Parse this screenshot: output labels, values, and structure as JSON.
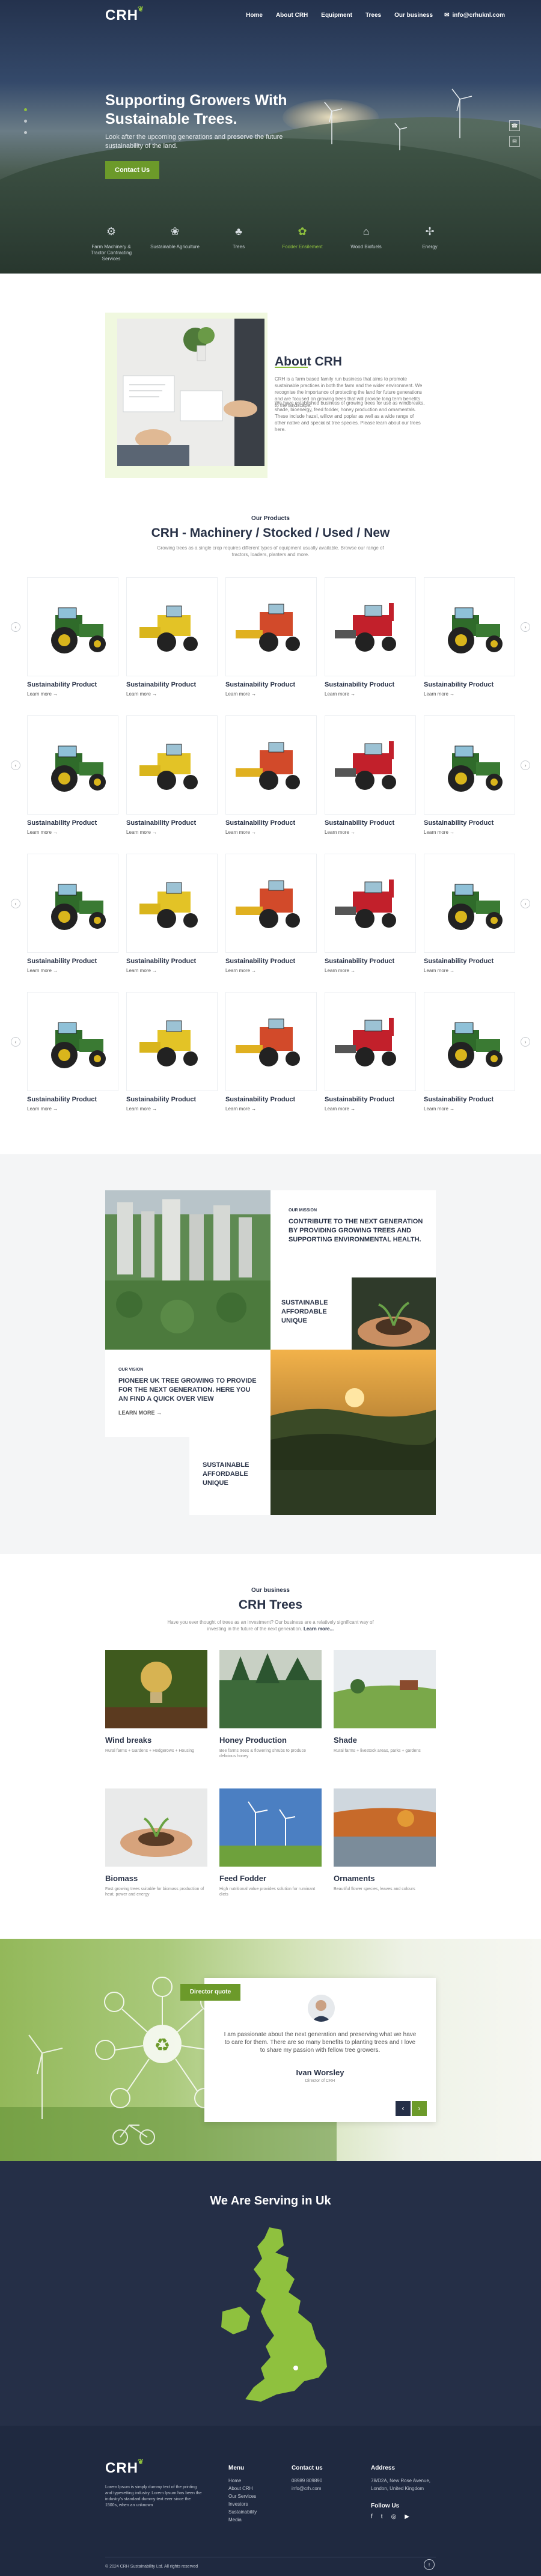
{
  "nav": {
    "logo": "CRH",
    "links": [
      "Home",
      "About CRH",
      "Equipment",
      "Trees",
      "Our business"
    ],
    "email": "info@crhuknl.com"
  },
  "hero": {
    "title": "Supporting Growers With Sustainable Trees.",
    "subtitle": "Look after the upcoming generations and preserve the future sustainability of the land.",
    "cta": "Contact Us",
    "features": [
      {
        "icon": "tractor-icon",
        "label": "Farm Machinery & Tractor Contracting Services"
      },
      {
        "icon": "seedling-icon",
        "label": "Sustainable Agriculture"
      },
      {
        "icon": "tree-icon",
        "label": "Trees"
      },
      {
        "icon": "fodder-icon",
        "label": "Fodder Ensilement"
      },
      {
        "icon": "farm-icon",
        "label": "Wood Biofuels"
      },
      {
        "icon": "wind-icon",
        "label": "Energy"
      }
    ]
  },
  "about": {
    "title": "About CRH",
    "p1": "CRH is a farm based family run business that aims to promote sustainable practices in both the farm and the wider environment. We recognise the importance of protecting the land for future generations and are focused on growing trees that will provide long term benefits to the landscape.",
    "p2": "We have established business of growing trees for use as windbreaks, shade, bioenergy, feed fodder, honey production and ornamentals. These include hazel, willow and poplar as well as a wide range of other native and specialist tree species. Please learn about our trees here."
  },
  "products": {
    "kicker": "Our Products",
    "title": "CRH - Machinery / Stocked / Used / New",
    "desc": "Growing trees as a single crop requires different types of equipment usually available. Browse our range of tractors, loaders, planters and more.",
    "item_name": "Sustainability Product",
    "item_link": "Learn more",
    "rows": [
      [
        "tractor",
        "harvester",
        "combine",
        "forage",
        "tractor"
      ],
      [
        "tractor",
        "harvester",
        "combine",
        "forage",
        "tractor"
      ],
      [
        "tractor",
        "harvester",
        "combine",
        "forage",
        "tractor"
      ],
      [
        "tractor",
        "harvester",
        "combine",
        "forage",
        "tractor"
      ]
    ]
  },
  "mission": {
    "mission_kicker": "OUR MISSION",
    "mission_text": "CONTRIBUTE TO THE NEXT GENERATION BY PROVIDING GROWING TREES AND SUPPORTING ENVIRONMENTAL HEALTH.",
    "badge1": "SUSTAINABLE AFFORDABLE UNIQUE",
    "vision_kicker": "OUR VISION",
    "vision_text": "PIONEER UK TREE GROWING TO PROVIDE FOR THE NEXT GENERATION. HERE YOU AN FIND A QUICK OVER VIEW",
    "learn_more": "LEARN MORE",
    "badge2": "SUSTAINABLE AFFORDABLE UNIQUE"
  },
  "trees": {
    "kicker": "Our business",
    "title": "CRH Trees",
    "desc": "Have you ever thought of trees as an investment? Our business are a relatively significant way of investing in the future of the next generation.",
    "desc_link": "Learn more...",
    "items": [
      {
        "title": "Wind breaks",
        "desc": "Rural farms + Gardens + Hedgerows + Housing"
      },
      {
        "title": "Honey Production",
        "desc": "Bee farms trees & flowering shrubs to produce delicious honey"
      },
      {
        "title": "Shade",
        "desc": "Rural farms + livestock areas, parks + gardens"
      },
      {
        "title": "Biomass",
        "desc": "Fast growing trees suitable for biomass production of heat, power and energy"
      },
      {
        "title": "Feed Fodder",
        "desc": "High nutritional value provides solution for ruminant diets"
      },
      {
        "title": "Ornaments",
        "desc": "Beautiful flower species, leaves and colours"
      }
    ]
  },
  "quote": {
    "tag": "Director quote",
    "text": "I am passionate about the next generation and preserving what we have to care for them. There are so many benefits to planting trees and I love to share my passion with fellow tree growers.",
    "name": "Ivan Worsley",
    "role": "Director of CRH"
  },
  "serving": {
    "title": "We Are Serving in Uk"
  },
  "footer": {
    "logo": "CRH",
    "about": "Lorem Ipsum is simply dummy text of the printing and typesetting industry. Lorem Ipsum has been the industry's standard dummy text ever since the 1500s, when an unknown",
    "menu_title": "Menu",
    "menu": [
      "Home",
      "About CRH",
      "Our Services",
      "Investors",
      "Sustainability",
      "Media"
    ],
    "contact_title": "Contact us",
    "phone": "08989 809890",
    "email": "info@crh.com",
    "address_title": "Address",
    "address": "78/D2A, New Rose Avenue, London, United Kingdom",
    "follow_title": "Follow Us",
    "copyright": "© 2024 CRH Sustainability Ltd. All rights reserved"
  },
  "colors": {
    "accent": "#6c9a2a",
    "navy": "#252f47",
    "title": "#2a3348"
  }
}
